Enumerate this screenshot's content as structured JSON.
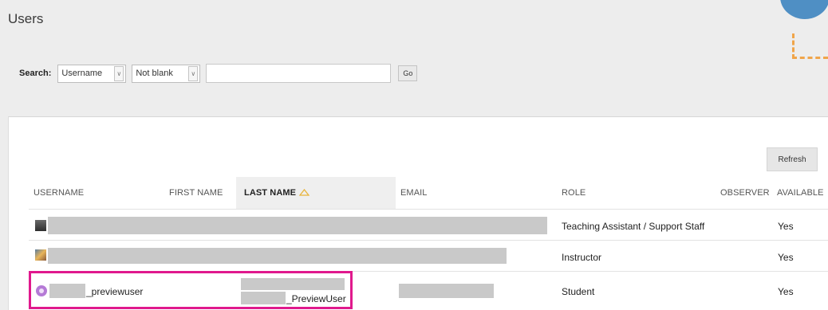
{
  "page": {
    "title": "Users"
  },
  "search": {
    "label": "Search:",
    "field_value": "Username",
    "condition_value": "Not blank",
    "query_value": "",
    "go_label": "Go"
  },
  "toolbar": {
    "refresh_label": "Refresh"
  },
  "table": {
    "columns": [
      "USERNAME",
      "FIRST NAME",
      "LAST NAME",
      "EMAIL",
      "ROLE",
      "OBSERVER",
      "AVAILABLE"
    ],
    "sorted_column": "LAST NAME",
    "sort_direction": "ascending",
    "rows": [
      {
        "role": "Teaching Assistant / Support Staff",
        "available": "Yes"
      },
      {
        "role": "Instructor",
        "available": "Yes"
      },
      {
        "username": "_previewuser",
        "last_name": "_PreviewUser",
        "role": "Student",
        "available": "Yes"
      }
    ]
  },
  "colors": {
    "highlight": "#e0198d",
    "sort_arrow": "#e8b33a",
    "panel": "#ffffff",
    "background": "#ededed"
  },
  "icons": {
    "sort": "triangle-up-icon",
    "dropdown": "chevron-down-icon"
  }
}
